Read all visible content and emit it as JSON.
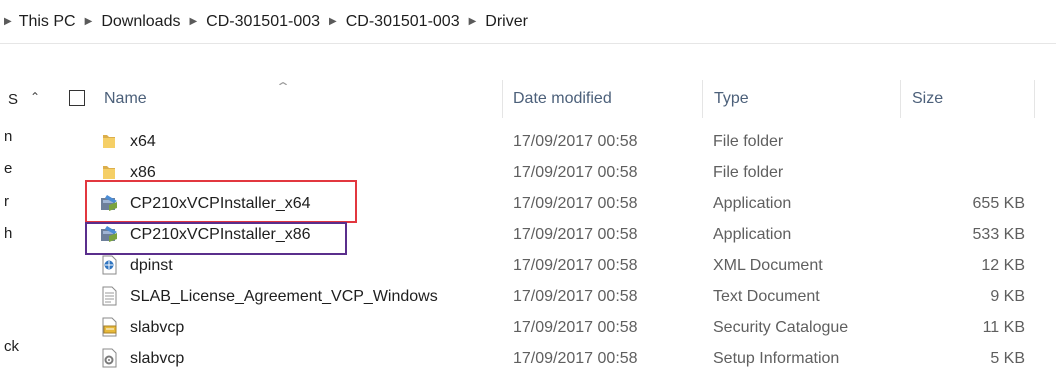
{
  "breadcrumb": {
    "items": [
      "This PC",
      "Downloads",
      "CD-301501-003",
      "CD-301501-003",
      "Driver"
    ]
  },
  "nav_pane": {
    "header_fragment": "S",
    "fragments": [
      "n",
      "e",
      "r",
      "h",
      "ck"
    ]
  },
  "columns": {
    "name": "Name",
    "date_modified": "Date modified",
    "type": "Type",
    "size": "Size"
  },
  "files": [
    {
      "name": "x64",
      "date": "17/09/2017 00:58",
      "type": "File folder",
      "size": "",
      "icon": "folder-icon"
    },
    {
      "name": "x86",
      "date": "17/09/2017 00:58",
      "type": "File folder",
      "size": "",
      "icon": "folder-icon"
    },
    {
      "name": "CP210xVCPInstaller_x64",
      "date": "17/09/2017 00:58",
      "type": "Application",
      "size": "655 KB",
      "icon": "installer-icon"
    },
    {
      "name": "CP210xVCPInstaller_x86",
      "date": "17/09/2017 00:58",
      "type": "Application",
      "size": "533 KB",
      "icon": "installer-icon"
    },
    {
      "name": "dpinst",
      "date": "17/09/2017 00:58",
      "type": "XML Document",
      "size": "12 KB",
      "icon": "xml-file-icon"
    },
    {
      "name": "SLAB_License_Agreement_VCP_Windows",
      "date": "17/09/2017 00:58",
      "type": "Text Document",
      "size": "9 KB",
      "icon": "text-file-icon"
    },
    {
      "name": "slabvcp",
      "date": "17/09/2017 00:58",
      "type": "Security Catalogue",
      "size": "11 KB",
      "icon": "catalog-file-icon"
    },
    {
      "name": "slabvcp",
      "date": "17/09/2017 00:58",
      "type": "Setup Information",
      "size": "5 KB",
      "icon": "setup-info-icon"
    }
  ],
  "highlight_colors": {
    "red": "#e2373f",
    "purple": "#5a2e8c"
  }
}
